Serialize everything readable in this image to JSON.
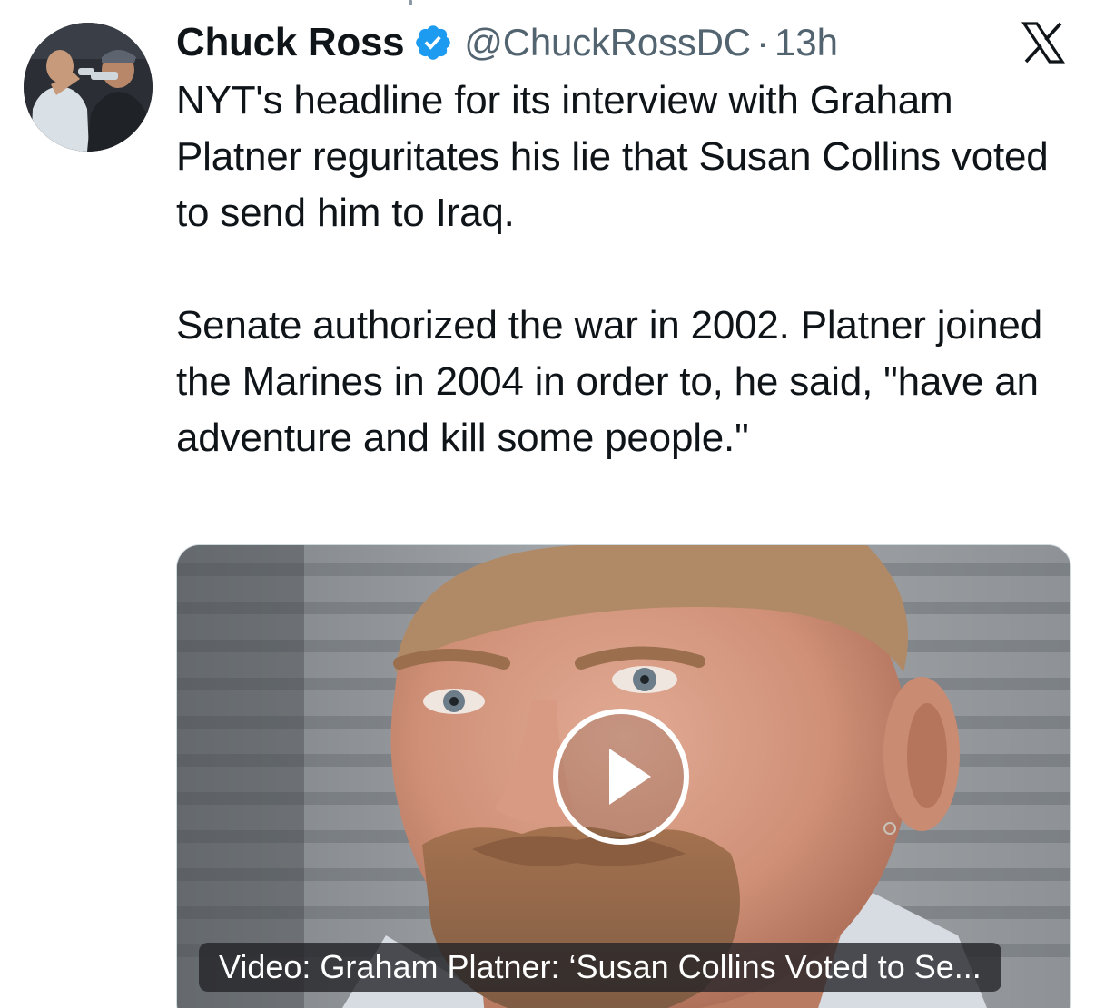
{
  "tweet": {
    "author": {
      "display_name": "Chuck Ross",
      "handle": "@ChuckRossDC",
      "verified": true,
      "verified_color": "#1d9bf0"
    },
    "separator": "·",
    "timestamp": "13h",
    "text_paragraphs": [
      "NYT's headline for its interview with Graham Platner reguritates his lie that Susan Collins voted to send him to Iraq.",
      "Senate authorized the war in 2002. Platner joined the Marines in 2004 in order to, he said, \"have an adventure and kill some people.\""
    ],
    "media": {
      "type": "video",
      "caption": "Video: Graham Platner: ‘Susan Collins Voted to Se...",
      "play_icon": "play-icon"
    },
    "platform_icon": "x-logo-icon"
  },
  "colors": {
    "text_primary": "#0f1419",
    "text_secondary": "#536471",
    "verified_blue": "#1d9bf0",
    "border": "#cfd9de"
  }
}
